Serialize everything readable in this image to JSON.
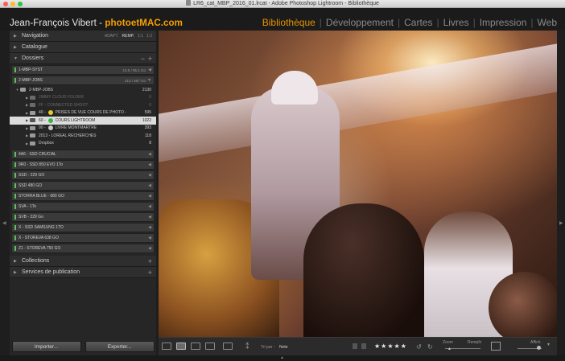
{
  "window": {
    "title": "LR6_cat_MBP_2016_01.lrcat - Adobe Photoshop Lightroom - Bibliothèque"
  },
  "brand": {
    "name": "Jean-François Vibert - ",
    "accent": "photoetMAC.com"
  },
  "modules": [
    "Bibliothèque",
    "Développement",
    "Cartes",
    "Livres",
    "Impression",
    "Web"
  ],
  "active_module": "Bibliothèque",
  "left_panel": {
    "navigator": {
      "label": "Navigation",
      "zoom_options": [
        "ADAPT.",
        "REMP.",
        "1:1",
        "1:2"
      ]
    },
    "catalog": {
      "label": "Catalogue"
    },
    "folders": {
      "label": "Dossiers",
      "volumes_top": [
        {
          "name": "1-MBP-SYST",
          "info": "13.5 / 95.1 Go"
        },
        {
          "name": "2-MBP-JOBS",
          "info": "413 / 557 Go"
        }
      ],
      "tree": [
        {
          "name": "2-MBP-JOBS",
          "count": "2130",
          "dim": false,
          "selected": false
        },
        {
          "name": "JIMMY CLOUD FOLDER",
          "count": "0",
          "dim": true,
          "selected": false
        },
        {
          "name": "FF - CONNECTED SHOOT",
          "count": "0",
          "dim": true,
          "selected": false
        },
        {
          "name": "40 -",
          "name2": "PRISES DE VUE COURS DE PHOTO -",
          "count": "595",
          "dim": false,
          "selected": false
        },
        {
          "name": "60 -",
          "name2": "COURS LIGHTROOM",
          "count": "1022",
          "dim": false,
          "selected": true
        },
        {
          "name": "90 -",
          "name2": "LIVRE MONTMARTRE",
          "count": "393",
          "dim": false,
          "selected": false
        },
        {
          "name": "2013 - LOREAL RECHERCHES",
          "count": "118",
          "dim": false,
          "selected": false
        },
        {
          "name": "Dropbox",
          "count": "8",
          "dim": false,
          "selected": false
        }
      ],
      "volumes_bottom": [
        "4A6 - SSD CRUCIAL",
        "9R0 - SSD 850 EVO 1To",
        "SSD - 229 GO",
        "SSD 480 GO",
        "STORHA BLUE - 680 GO",
        "SVA - 1To",
        "SVB - 229 Go",
        "X - SSD SAMSUNG 1TO",
        "X - STOREVA 638 GO",
        "Z1 - STOREVA 750 GO"
      ]
    },
    "collections": {
      "label": "Collections"
    },
    "publish": {
      "label": "Services de publication"
    },
    "import_button": "Importer...",
    "export_button": "Exporter..."
  },
  "toolbar": {
    "sort_label": "Tri par :",
    "sort_value": "Note",
    "rating": "★★★★★",
    "zoom_label": "Zoom",
    "fill_label": "Remplir",
    "display_label": "Affich."
  }
}
